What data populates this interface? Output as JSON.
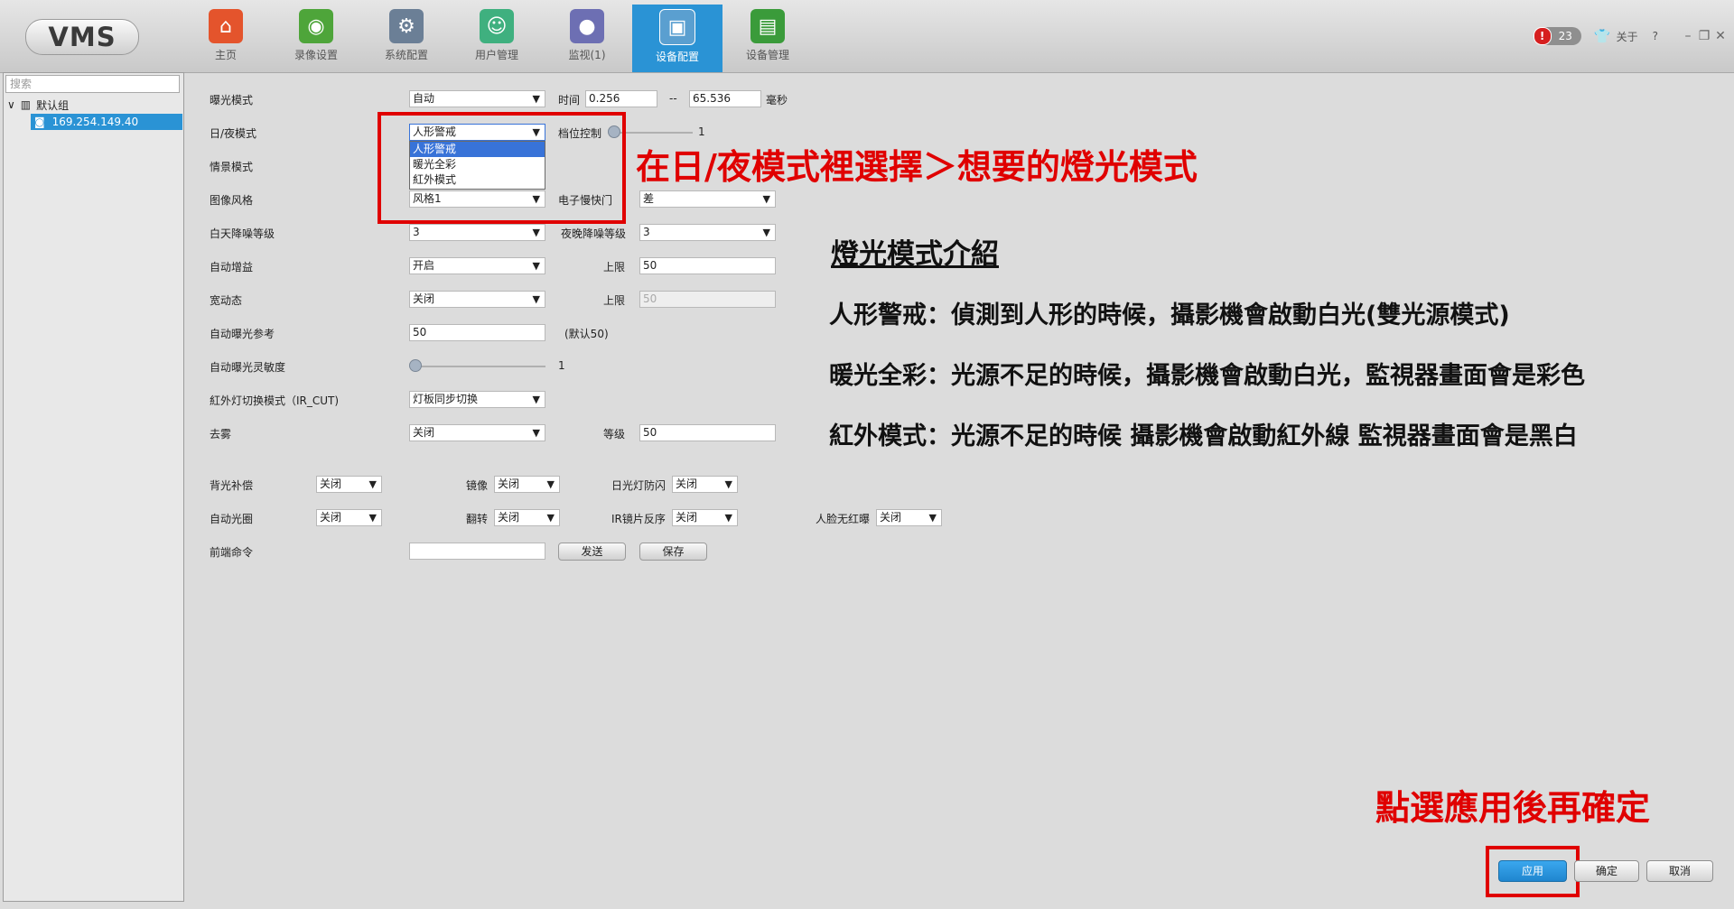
{
  "header": {
    "logo": "VMS",
    "nav": [
      {
        "label": "主页",
        "icon": "home-icon",
        "color": "#e4542c"
      },
      {
        "label": "录像设置",
        "icon": "record-settings-icon",
        "color": "#4ea53a"
      },
      {
        "label": "系统配置",
        "icon": "gear-icon",
        "color": "#6b7f96"
      },
      {
        "label": "用户管理",
        "icon": "user-icon",
        "color": "#3fb07f"
      },
      {
        "label": "监视(1)",
        "icon": "camera-icon",
        "color": "#6d6fb3"
      },
      {
        "label": "设备配置",
        "icon": "device-config-icon",
        "color": "#2a93d5"
      },
      {
        "label": "设备管理",
        "icon": "device-manage-icon",
        "color": "#3a9b3a"
      }
    ],
    "alarm_count": "23",
    "about": "关于",
    "help": "?",
    "active_color": "#2a93d5"
  },
  "sidebar": {
    "search_placeholder": "搜索",
    "group": "默认组",
    "device": "169.254.149.40"
  },
  "form": {
    "exposure_mode": {
      "label": "曝光模式",
      "value": "自动",
      "time_label": "时间",
      "time_min": "0.256",
      "sep": "--",
      "time_max": "65.536",
      "unit": "毫秒"
    },
    "day_night": {
      "label": "日/夜模式",
      "value": "人形警戒",
      "gear_label": "档位控制",
      "gear_value": "1",
      "options": [
        "人形警戒",
        "暖光全彩",
        "紅外模式"
      ]
    },
    "scene_mode": {
      "label": "情景模式"
    },
    "image_style": {
      "label": "图像风格",
      "value": "风格1",
      "shutter_label": "电子慢快门",
      "shutter_value": "差"
    },
    "day_nr": {
      "label": "白天降噪等级",
      "value": "3",
      "night_label": "夜晚降噪等级",
      "night_value": "3"
    },
    "agc": {
      "label": "自动增益",
      "value": "开启",
      "limit_label": "上限",
      "limit_value": "50"
    },
    "wdr": {
      "label": "宽动态",
      "value": "关闭",
      "limit_label": "上限",
      "limit_value": "50"
    },
    "ae_ref": {
      "label": "自动曝光参考",
      "value": "50",
      "hint": "(默认50)"
    },
    "ae_sens": {
      "label": "自动曝光灵敏度",
      "value": "1"
    },
    "ircut": {
      "label": "紅外灯切换模式（IR_CUT)",
      "value": "灯板同步切换"
    },
    "defog": {
      "label": "去雾",
      "value": "关闭",
      "level_label": "等级",
      "level_value": "50"
    },
    "blc": {
      "label": "背光补偿",
      "value": "关闭"
    },
    "mirror": {
      "label": "镜像",
      "value": "关闭"
    },
    "anti_flicker": {
      "label": "日光灯防闪",
      "value": "关闭"
    },
    "auto_iris": {
      "label": "自动光圈",
      "value": "关闭"
    },
    "flip": {
      "label": "翻转",
      "value": "关闭"
    },
    "ir_swap": {
      "label": "IR镜片反序",
      "value": "关闭"
    },
    "face_ir": {
      "label": "人脸无红曝",
      "value": "关闭"
    },
    "front_cmd": {
      "label": "前端命令",
      "value": "",
      "send": "发送",
      "save": "保存"
    }
  },
  "annotations": {
    "select_hint": "在日/夜模式裡選擇＞想要的燈光模式",
    "intro_title": "燈光模式介紹",
    "lines": [
      "人形警戒：偵測到人形的時候，攝影機會啟動白光(雙光源模式)",
      "暖光全彩：光源不足的時候，攝影機會啟動白光，監視器畫面會是彩色",
      "紅外模式：光源不足的時候 攝影機會啟動紅外線 監視器畫面會是黑白"
    ],
    "apply_hint": "點選應用後再確定",
    "highlight_color": "#e00000"
  },
  "actions": {
    "apply": "应用",
    "ok": "确定",
    "cancel": "取消"
  }
}
